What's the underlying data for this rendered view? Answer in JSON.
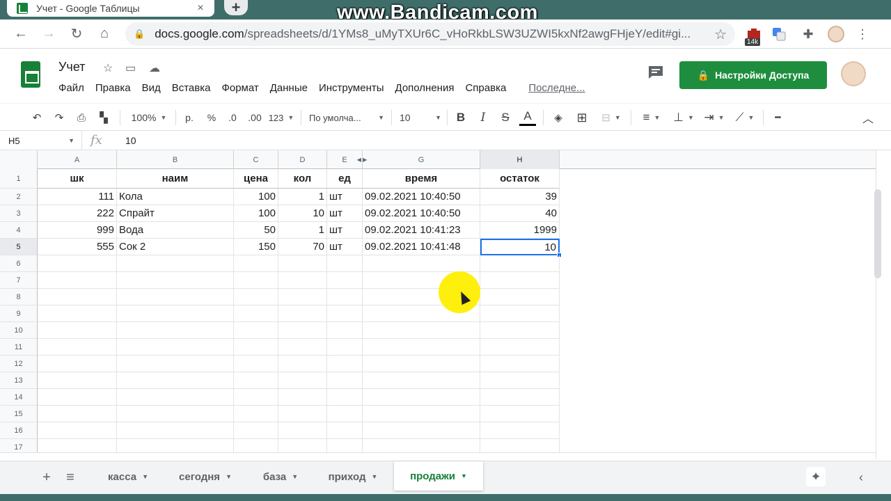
{
  "browser": {
    "tab_title": "Учет - Google Таблицы",
    "tab_close": "×",
    "new_tab": "+",
    "url_host": "docs.google.com",
    "url_path": "/spreadsheets/d/1YMs8_uMyTXUr6C_vHoRkbLSW3UZWI5kxNf2awgFHjeY/edit#gi...",
    "watermark": "www.Bandicam.com",
    "ext_badge": "14k"
  },
  "doc": {
    "title": "Учет",
    "menu": [
      "Файл",
      "Правка",
      "Вид",
      "Вставка",
      "Формат",
      "Данные",
      "Инструменты",
      "Дополнения",
      "Справка"
    ],
    "last_edit": "Последне...",
    "share_label": "Настройки Доступа"
  },
  "toolbar": {
    "zoom": "100%",
    "currency": "р.",
    "percent": "%",
    "dec_less": ".0",
    "dec_more": ".00",
    "format_more": "123",
    "font": "По умолча...",
    "font_size": "10",
    "bold": "B",
    "italic": "I",
    "strike": "S",
    "text_color": "A",
    "more": "•••"
  },
  "formula_bar": {
    "cell_ref": "H5",
    "fx": "fx",
    "value": "10"
  },
  "columns": [
    "A",
    "B",
    "C",
    "D",
    "E",
    "G",
    "H"
  ],
  "rows": [
    "1",
    "2",
    "3",
    "4",
    "5",
    "6",
    "7",
    "8",
    "9",
    "10",
    "11",
    "12",
    "13",
    "14",
    "15",
    "16",
    "17"
  ],
  "header_row": [
    "шк",
    "наим",
    "цена",
    "кол",
    "ед",
    "время",
    "остаток"
  ],
  "data_rows": [
    [
      "111",
      "Кола",
      "100",
      "1",
      "шт",
      "09.02.2021 10:40:50",
      "39"
    ],
    [
      "222",
      "Спрайт",
      "100",
      "10",
      "шт",
      "09.02.2021 10:40:50",
      "40"
    ],
    [
      "999",
      "Вода",
      "50",
      "1",
      "шт",
      "09.02.2021 10:41:23",
      "1999"
    ],
    [
      "555",
      "Сок 2",
      "150",
      "70",
      "шт",
      "09.02.2021 10:41:48",
      "10"
    ]
  ],
  "sheets": {
    "add": "+",
    "list": "≡",
    "tabs": [
      "касса",
      "сегодня",
      "база",
      "приход",
      "продажи"
    ],
    "active": "продажи"
  },
  "colors": {
    "accent_green": "#1e8e3e",
    "selection_blue": "#1a73e8",
    "cursor_highlight": "#ffee00"
  }
}
